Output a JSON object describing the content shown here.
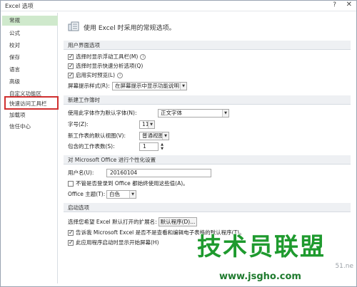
{
  "window": {
    "title": "Excel 选项",
    "help_icon": "?",
    "close_icon": "✕"
  },
  "sidebar": {
    "items": [
      {
        "label": "常规"
      },
      {
        "label": "公式"
      },
      {
        "label": "校对"
      },
      {
        "label": "保存"
      },
      {
        "label": "语言"
      },
      {
        "label": "高级"
      },
      {
        "label": "自定义功能区"
      },
      {
        "label": "快速访问工具栏"
      },
      {
        "label": "加载项"
      },
      {
        "label": "信任中心"
      }
    ]
  },
  "header": {
    "text": "使用 Excel 时采用的常规选项。"
  },
  "ui_options": {
    "section": "用户界面选项",
    "cb1": "选择时显示浮动工具栏(M)",
    "cb2": "选择时显示快速分析选项(Q)",
    "cb3": "启用实时预览(L)",
    "screentip_label": "屏幕提示样式(R):",
    "screentip_value": "在屏幕提示中显示功能说明"
  },
  "new_workbook": {
    "section": "新建工作簿时",
    "font_label": "使用此字体作为默认字体(N):",
    "font_value": "正文字体",
    "size_label": "字号(Z):",
    "size_value": "11",
    "view_label": "新工作表的默认视图(V):",
    "view_value": "普通视图",
    "sheets_label": "包含的工作表数(S):",
    "sheets_value": "1"
  },
  "personalize": {
    "section": "对 Microsoft Office 进行个性化设置",
    "username_label": "用户名(U):",
    "username_value": "20160104",
    "always_use_label": "不管是否登录到 Office 都始终使用这些值(A)。",
    "theme_label": "Office 主题(T):",
    "theme_value": "白色"
  },
  "startup": {
    "section": "启动选项",
    "ext_label": "选择您希望 Excel 默认打开的扩展名:",
    "default_programs_button": "默认程序(D)...",
    "notify_label": "告诉我 Microsoft Excel 是否不是查看和编辑电子表格的默认程序(T)。",
    "show_start_label": "此应用程序启动时显示开始屏幕(H)"
  },
  "watermark": {
    "brand": "技术员联盟",
    "url": "www.jsgho.com",
    "corner": "51.ne"
  }
}
